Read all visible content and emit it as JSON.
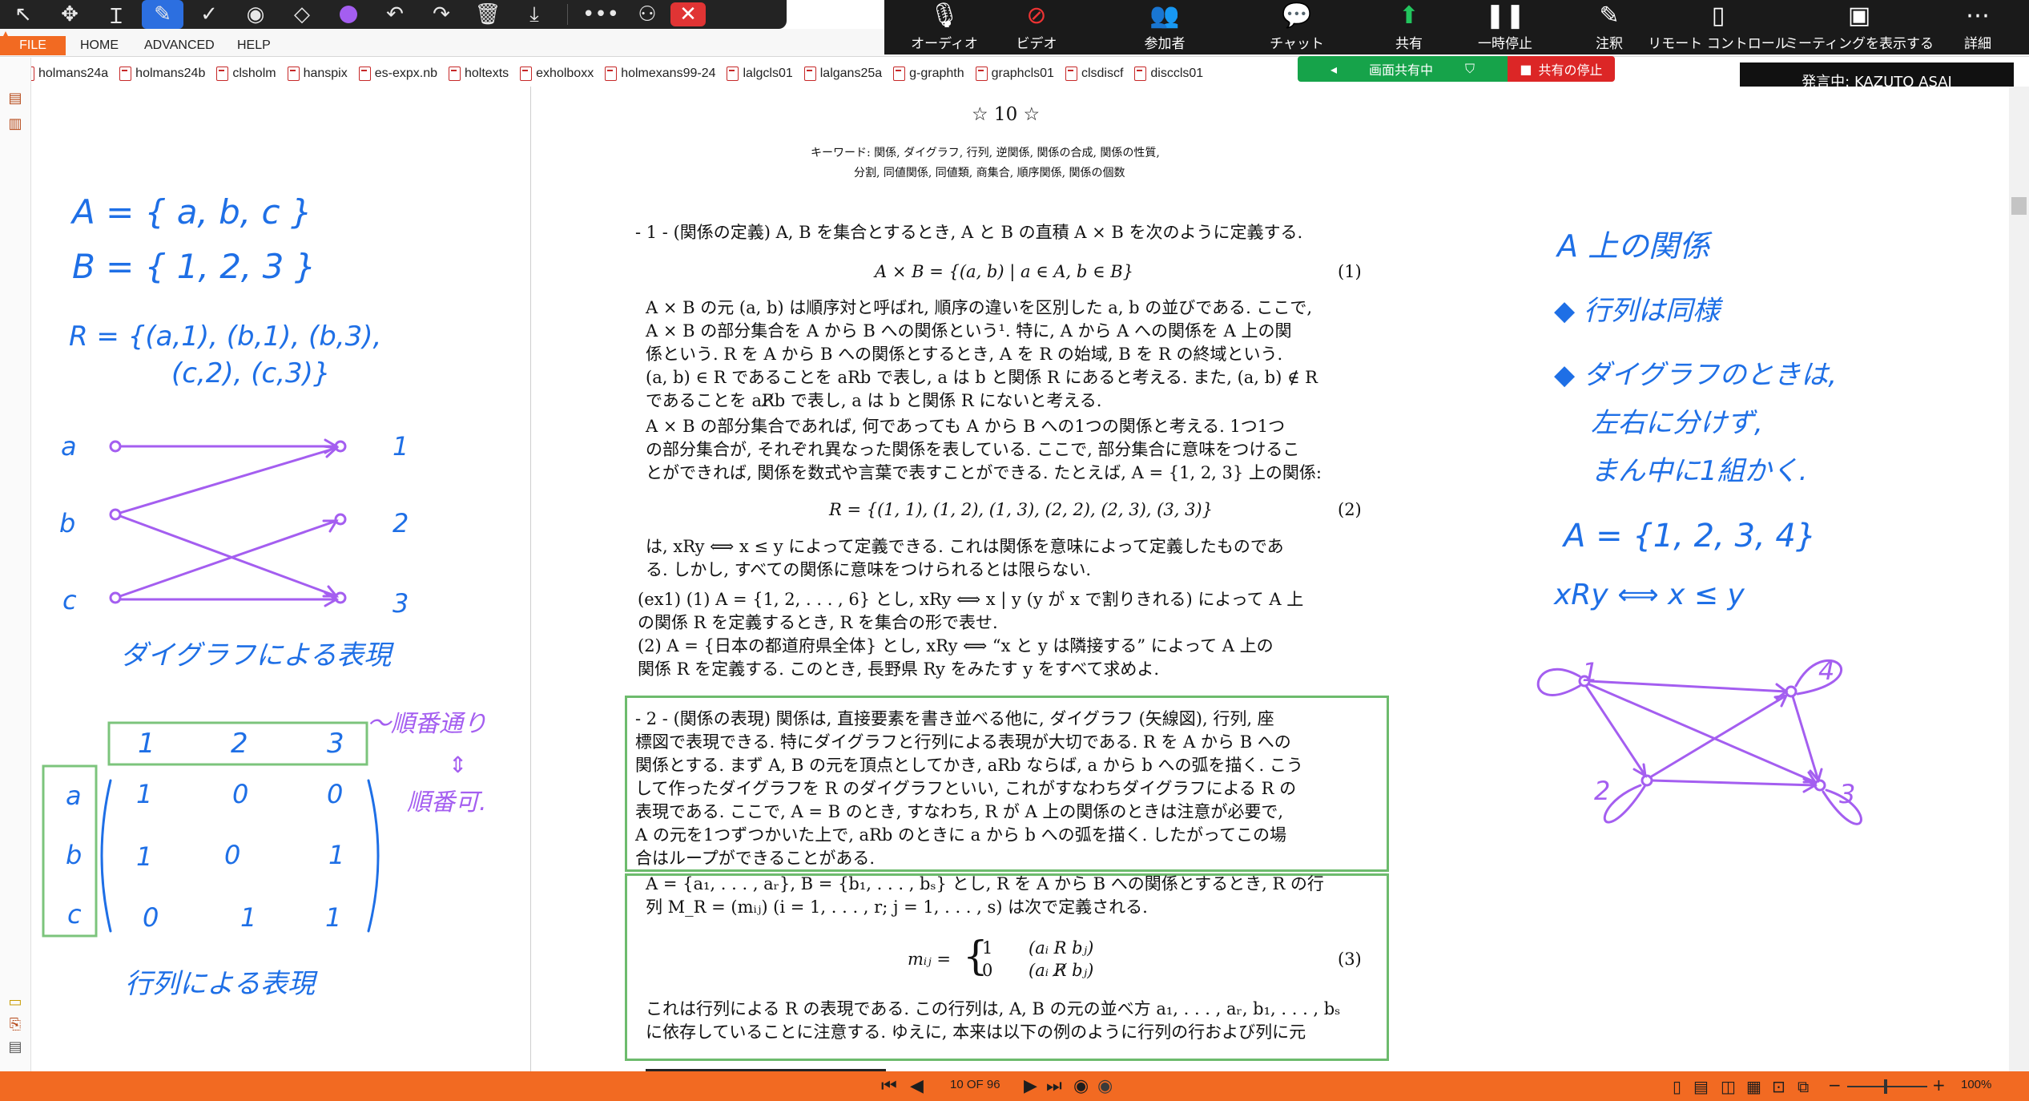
{
  "annotation_toolbar": {
    "tools": [
      "select-arrow-icon",
      "move-icon",
      "text-cursor-icon",
      "pen-icon",
      "check-icon",
      "stamp-icon",
      "eraser-icon",
      "color-dot-icon",
      "undo-icon",
      "redo-icon",
      "trash-icon",
      "download-icon",
      "more-icon",
      "share-user-icon",
      "close-icon"
    ]
  },
  "menu": {
    "file": "FILE",
    "home": "HOME",
    "advanced": "ADVANCED",
    "help": "HELP"
  },
  "meeting": {
    "audio": "オーディオ",
    "video": "ビデオ",
    "participants": "参加者",
    "chat": "チャット",
    "share": "共有",
    "pause": "一時停止",
    "annotate": "注釈",
    "remote_control": "リモート コントロール",
    "show_meeting": "ミーティングを表示する",
    "more": "詳細",
    "sharing": "画面共有中",
    "stop_share": "共有の停止",
    "speaker": "発言中: KAZUTO ASAI",
    "share_color": "#16a34a",
    "stop_color": "#dc2626"
  },
  "tabs": [
    "holmans24a",
    "holmans24b",
    "clsholm",
    "hanspix",
    "es-expx.nb",
    "holtexts",
    "exholboxx",
    "holmexans99-24",
    "lalgcls01",
    "lalgans25a",
    "g-graphth",
    "graphcls01",
    "clsdiscf",
    "disccls01"
  ],
  "doc": {
    "title": "☆ 10 ☆",
    "keywords_1": "キーワード: 関係, ダイグラフ, 行列, 逆関係, 関係の合成, 関係の性質,",
    "keywords_2": "分割, 同値関係, 同値類, 商集合, 順序関係, 関係の個数",
    "s1_head": "- 1 - (関係の定義) A, B を集合とするとき, A と B の直積 A × B を次のように定義する.",
    "eq1": "A × B = {(a, b) | a ∈ A, b ∈ B}",
    "eq1_no": "(1)",
    "p1": [
      "A × B の元 (a, b) は順序対と呼ばれ, 順序の違いを区別した a, b の並びである. ここで,",
      "A × B の部分集合を A から B への関係という¹. 特に, A から A への関係を A 上の関",
      "係という. R を A から B への関係とするとき, A を R の始域, B を R の終域という.",
      "(a, b) ∈ R であることを aRb で表し, a は b と関係 R にあると考える. また, (a, b) ∉ R",
      "であることを aR̸b で表し, a は b と関係 R にないと考える."
    ],
    "p2": [
      "A × B の部分集合であれば, 何であっても A から B への1つの関係と考える. 1つ1つ",
      "の部分集合が, それぞれ異なった関係を表している. ここで, 部分集合に意味をつけるこ",
      "とができれば, 関係を数式や言葉で表すことができる. たとえば, A = {1, 2, 3} 上の関係:"
    ],
    "eq2": "R = {(1, 1), (1, 2), (1, 3), (2, 2), (2, 3), (3, 3)}",
    "eq2_no": "(2)",
    "p3": [
      "は, xRy ⟺ x ≤ y によって定義できる. これは関係を意味によって定義したものであ",
      "る. しかし, すべての関係に意味をつけられるとは限らない."
    ],
    "ex1": [
      "(ex1) (1) A = {1, 2, . . . , 6} とし, xRy ⟺ x | y (y が x で割りきれる) によって A 上",
      "の関係 R を定義するとき, R を集合の形で表せ.",
      "(2) A = {日本の都道府県全体} とし, xRy ⟺ “x と y は隣接する” によって A 上の",
      "関係 R を定義する. このとき, 長野県 Ry をみたす y をすべて求めよ."
    ],
    "s2": [
      "- 2 - (関係の表現) 関係は, 直接要素を書き並べる他に, ダイグラフ (矢線図), 行列, 座",
      "標図で表現できる. 特にダイグラフと行列による表現が大切である. R を A から B への",
      "関係とする. まず A, B の元を頂点としてかき, aRb ならば, a から b への弧を描く. こう",
      "して作ったダイグラフを R のダイグラフといい, これがすなわちダイグラフによる R の",
      "表現である. ここで, A = B のとき, すなわち, R が A 上の関係のときは注意が必要で,",
      "A の元を1つずつかいた上で, aRb のときに a から b への弧を描く. したがってこの場",
      "合はループができることがある."
    ],
    "s3": [
      "A = {a₁, . . . , aᵣ}, B = {b₁, . . . , bₛ} とし, R を A から B への関係とするとき, R の行",
      "列 M_R = (mᵢⱼ) (i = 1, . . . , r; j = 1, . . . , s) は次で定義される."
    ],
    "eq3_lhs": "mᵢⱼ =",
    "eq3_case1": "1",
    "eq3_cond1": "(aᵢ R bⱼ)",
    "eq3_case0": "0",
    "eq3_cond0": "(aᵢ R̸ bⱼ)",
    "eq3_no": "(3)",
    "s3_tail": [
      "これは行列による R の表現である. この行列は, A, B の元の並べ方 a₁, . . . , aᵣ, b₁, . . . , bₛ",
      "に依存していることに注意する. ゆえに, 本来は以下の例のように行列の行および列に元"
    ]
  },
  "handwriting_left": {
    "setA": "A = { a, b, c }",
    "setB": "B = { 1, 2, 3 }",
    "relR_1": "R = {(a,1), (b,1), (b,3),",
    "relR_2": "(c,2), (c,3)}",
    "nodes_left": [
      "a",
      "b",
      "c"
    ],
    "nodes_right": [
      "1",
      "2",
      "3"
    ],
    "digraph_caption": "ダイグラフによる表現",
    "col_headers": [
      "1",
      "2",
      "3"
    ],
    "row_headers": [
      "a",
      "b",
      "c"
    ],
    "matrix": [
      [
        "1",
        "0",
        "0"
      ],
      [
        "1",
        "0",
        "1"
      ],
      [
        "0",
        "1",
        "1"
      ]
    ],
    "order_note_1": "〜順番通り",
    "order_note_2": "⇕",
    "order_note_3": "順番可.",
    "matrix_caption": "行列による表現"
  },
  "handwriting_right": {
    "line1": "A 上の関係",
    "line2": "◆ 行列は同様",
    "line3": "◆ ダイグラフのときは,",
    "line4": "左右に分けず,",
    "line5": "まん中に1組かく.",
    "setA": "A = {1, 2, 3, 4}",
    "rel": "xRy ⟺ x ≤ y",
    "nodes": [
      "1",
      "2",
      "3",
      "4"
    ]
  },
  "statusbar": {
    "page": "10 OF 96",
    "zoom": "100%"
  },
  "colors": {
    "accent": "#f26a22",
    "ink_blue": "#1e6fe6",
    "ink_purple": "#a45ef0",
    "box_green": "#6dbb6d"
  }
}
